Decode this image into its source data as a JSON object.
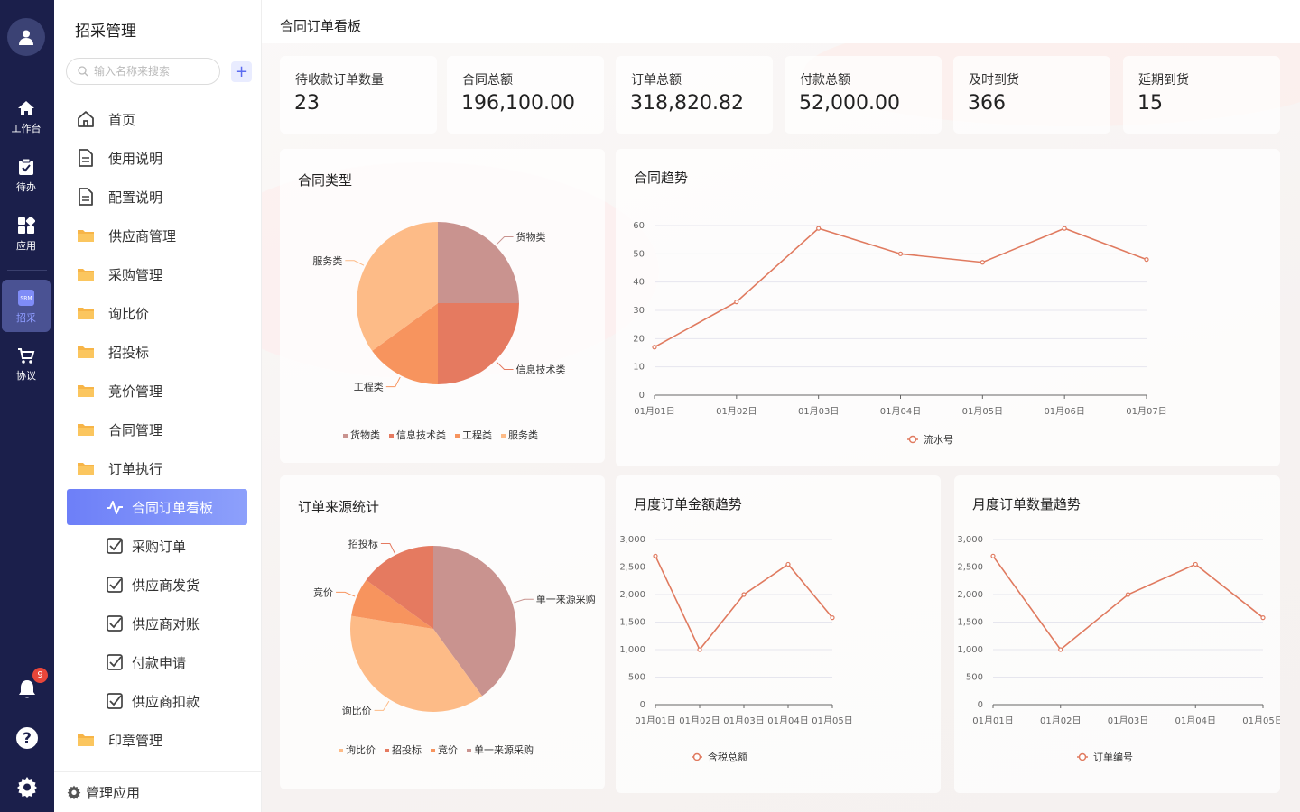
{
  "rail": {
    "items": [
      {
        "label": "工作台",
        "icon": "home-icon"
      },
      {
        "label": "待办",
        "icon": "clipboard-icon"
      },
      {
        "label": "应用",
        "icon": "apps-icon"
      },
      {
        "label": "招采",
        "icon": "srm-icon",
        "badge": "SRM",
        "active": true
      },
      {
        "label": "协议",
        "icon": "cart-icon"
      }
    ],
    "notification_count": "9"
  },
  "sidebar": {
    "title": "招采管理",
    "search_placeholder": "输入名称来搜索",
    "add_label": "+",
    "items": [
      {
        "label": "首页",
        "icon": "home-outline-icon"
      },
      {
        "label": "使用说明",
        "icon": "document-icon"
      },
      {
        "label": "配置说明",
        "icon": "document-icon"
      },
      {
        "label": "供应商管理",
        "icon": "folder-icon"
      },
      {
        "label": "采购管理",
        "icon": "folder-icon"
      },
      {
        "label": "询比价",
        "icon": "folder-icon"
      },
      {
        "label": "招投标",
        "icon": "folder-icon"
      },
      {
        "label": "竞价管理",
        "icon": "folder-icon"
      },
      {
        "label": "合同管理",
        "icon": "folder-icon"
      },
      {
        "label": "订单执行",
        "icon": "folder-icon"
      },
      {
        "label": "合同订单看板",
        "icon": "pulse-icon",
        "active": true
      },
      {
        "label": "采购订单",
        "icon": "checkbox-icon"
      },
      {
        "label": "供应商发货",
        "icon": "checkbox-icon"
      },
      {
        "label": "供应商对账",
        "icon": "checkbox-icon"
      },
      {
        "label": "付款申请",
        "icon": "checkbox-icon"
      },
      {
        "label": "供应商扣款",
        "icon": "checkbox-icon"
      },
      {
        "label": "印章管理",
        "icon": "folder-icon"
      }
    ],
    "footer_label": "管理应用"
  },
  "page": {
    "title": "合同订单看板"
  },
  "stats": [
    {
      "label": "待收款订单数量",
      "value": "23"
    },
    {
      "label": "合同总额",
      "value": "196,100.00"
    },
    {
      "label": "订单总额",
      "value": "318,820.82"
    },
    {
      "label": "付款总额",
      "value": "52,000.00"
    },
    {
      "label": "及时到货",
      "value": "366"
    },
    {
      "label": "延期到货",
      "value": "15"
    }
  ],
  "colors": {
    "accent": "#6d7ff8",
    "line": "#e07a5f",
    "pie": [
      "#c9938f",
      "#e57a60",
      "#f7945e",
      "#fdbb87"
    ],
    "rail": "#1b1f4b"
  },
  "chart_data": [
    {
      "type": "pie",
      "title": "合同类型",
      "categories": [
        "货物类",
        "信息技术类",
        "工程类",
        "服务类"
      ],
      "values": [
        25,
        25,
        15,
        35
      ],
      "colors": [
        "#c9938f",
        "#e57a60",
        "#f7945e",
        "#fdbb87"
      ],
      "legend": "bottom"
    },
    {
      "type": "line",
      "title": "合同趋势",
      "x": [
        "01月01日",
        "01月02日",
        "01月03日",
        "01月04日",
        "01月05日",
        "01月06日",
        "01月07日"
      ],
      "series": [
        {
          "name": "流水号",
          "values": [
            17,
            33,
            59,
            50,
            47,
            59,
            48
          ]
        }
      ],
      "yticks": [
        "0",
        "10",
        "20",
        "30",
        "40",
        "50",
        "60"
      ],
      "ylim": [
        0,
        60
      ],
      "grid": true,
      "legend": "bottom"
    },
    {
      "type": "pie",
      "title": "订单来源统计",
      "categories": [
        "单一来源采购",
        "询比价",
        "竞价",
        "招投标"
      ],
      "values": [
        40,
        37.5,
        7.5,
        15
      ],
      "legend_order": [
        "询比价",
        "招投标",
        "竞价",
        "单一来源采购"
      ],
      "colors": {
        "询比价": "#fdbb87",
        "招投标": "#e57a60",
        "竞价": "#f7945e",
        "单一来源采购": "#c9938f"
      },
      "legend": "bottom"
    },
    {
      "type": "line",
      "title": "月度订单金额趋势",
      "x": [
        "01月01日",
        "01月02日",
        "01月03日",
        "01月04日",
        "01月05日"
      ],
      "series": [
        {
          "name": "含税总额",
          "values": [
            2700,
            1000,
            2000,
            2550,
            1580
          ]
        }
      ],
      "yticks": [
        "0",
        "500",
        "1,000",
        "1,500",
        "2,000",
        "2,500",
        "3,000"
      ],
      "ylim": [
        0,
        3000
      ],
      "grid": true,
      "legend": "bottom"
    },
    {
      "type": "line",
      "title": "月度订单数量趋势",
      "x": [
        "01月01日",
        "01月02日",
        "01月03日",
        "01月04日",
        "01月05日"
      ],
      "series": [
        {
          "name": "订单编号",
          "values": [
            2700,
            1000,
            2000,
            2550,
            1580
          ]
        }
      ],
      "yticks": [
        "0",
        "500",
        "1,000",
        "1,500",
        "2,000",
        "2,500",
        "3,000"
      ],
      "ylim": [
        0,
        3000
      ],
      "grid": true,
      "legend": "bottom"
    }
  ]
}
